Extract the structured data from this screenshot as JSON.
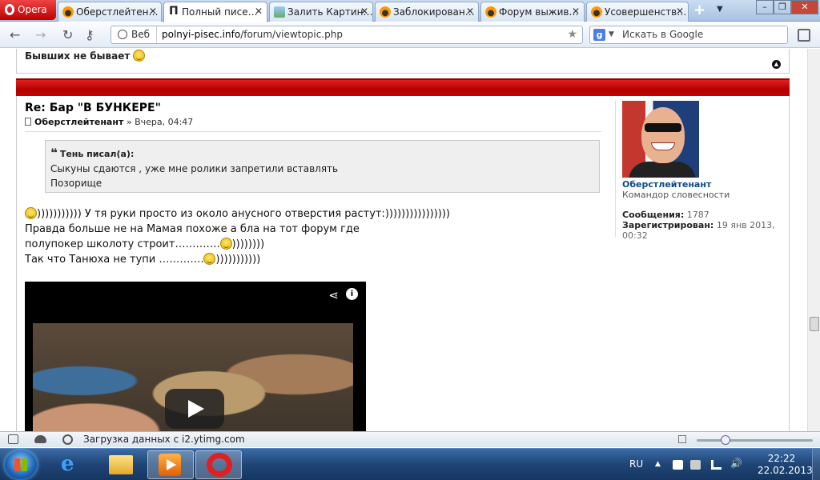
{
  "browser": {
    "opera_label": "Opera",
    "tabs": [
      {
        "title": "Оберстлейтен…",
        "favicon": "forum-favicon"
      },
      {
        "title": "Полный писе…",
        "favicon": "site-p-favicon",
        "active": true
      },
      {
        "title": "Залить Картин…",
        "favicon": "image-favicon"
      },
      {
        "title": "Заблокирован…",
        "favicon": "forum-favicon"
      },
      {
        "title": "Форум выжив…",
        "favicon": "forum-favicon"
      },
      {
        "title": "Усовершенств…",
        "favicon": "forum-favicon"
      }
    ],
    "new_tab_symbol": "+",
    "address": {
      "mode_label": "Веб",
      "url_domain": "polnyi-pisec.info",
      "url_path": "/forum/viewtopic.php"
    },
    "search": {
      "placeholder": "Искать в Google",
      "engine_letter": "g"
    }
  },
  "previous_post": {
    "signature": "Бывших не бывает"
  },
  "post": {
    "title": "Re: Бар \"В БУНКЕРЕ\"",
    "author": "Оберстлейтенант",
    "meta_sep": " » ",
    "date": "Вчера, 04:47",
    "quote": {
      "header": "Тень писал(а):",
      "lines": [
        "Сыкуны сдаются , уже мне ролики запретили вставлять",
        "Позорище"
      ]
    },
    "body": [
      ")))))))))))  У тя руки просто из около анусного отверстия растут:))))))))))))))))",
      "Правда больше не на Мамая похоже а бла на тот форум где",
      "полупокер школоту строит………….",
      "))))))))",
      "Так что Танюха не тупи ………….",
      ")))))))))))"
    ]
  },
  "profile": {
    "name": "Оберстлейтенант",
    "rank": "Командор словесности",
    "posts_label": "Сообщения:",
    "posts_value": "1787",
    "registered_label": "Зарегистрирован:",
    "registered_value": "19 янв 2013, 00:32"
  },
  "status_bar": {
    "text": "Загрузка данных с i2.ytimg.com",
    "zoom_level": 0.25
  },
  "taskbar": {
    "language": "RU",
    "time": "22:22",
    "date": "22.02.2013"
  }
}
